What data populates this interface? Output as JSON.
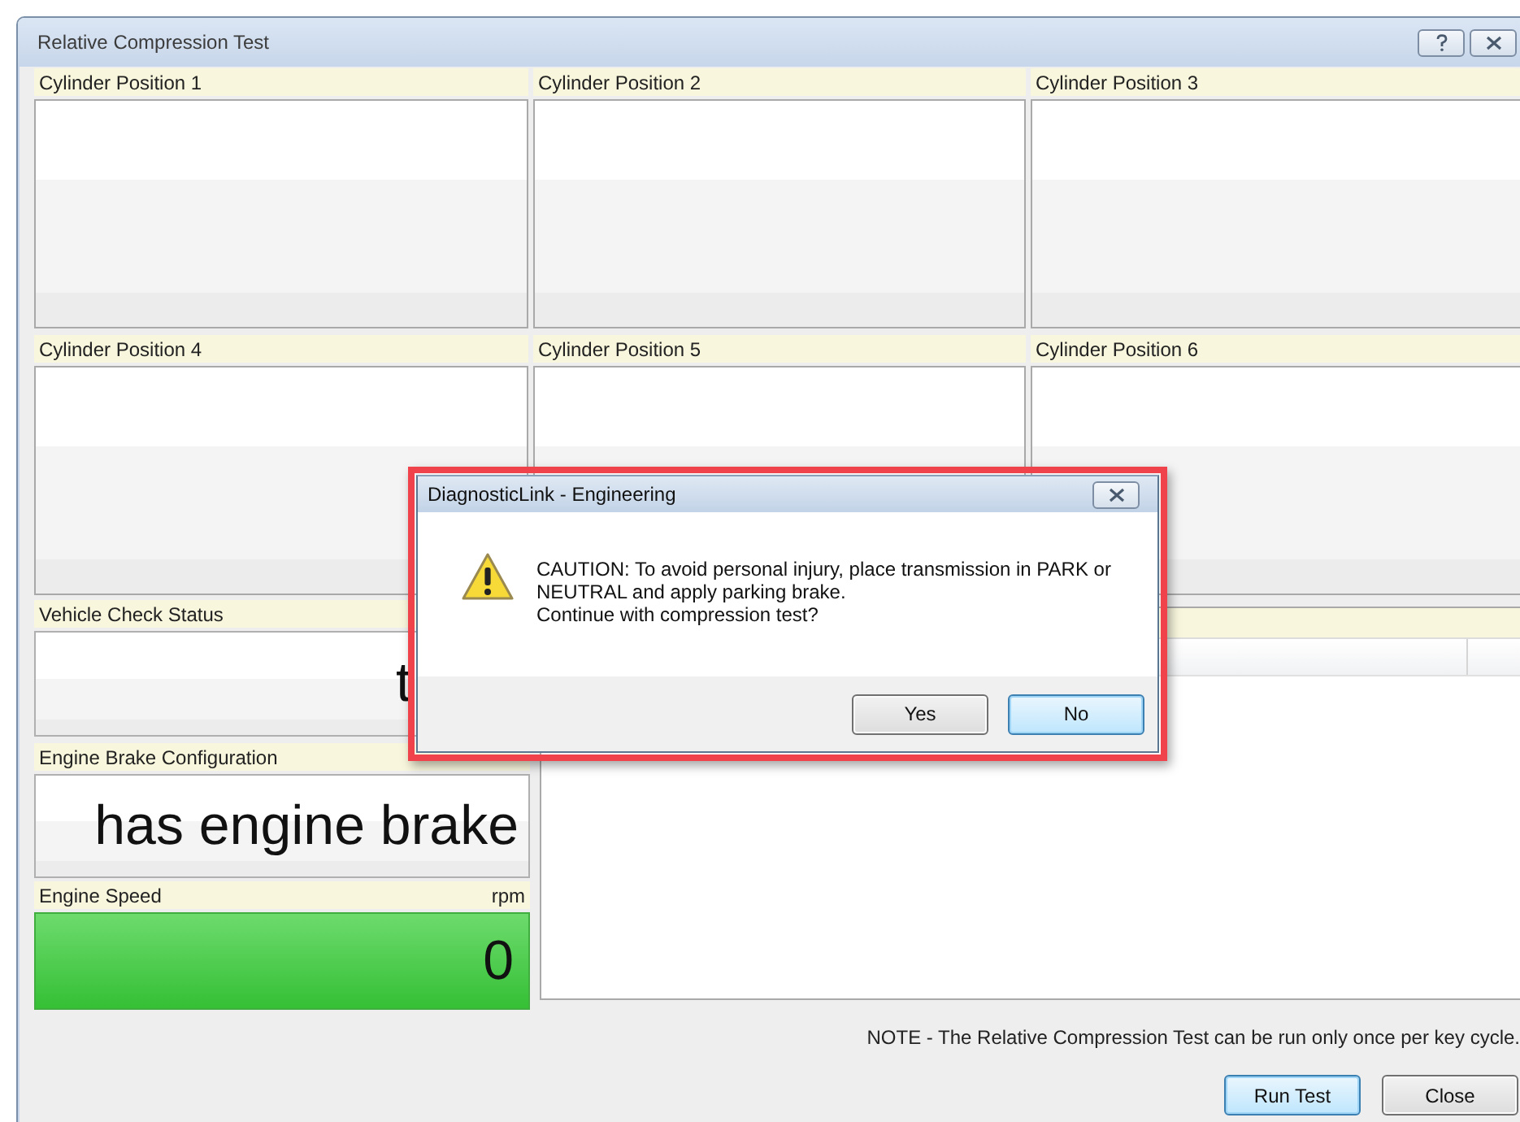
{
  "window": {
    "title": "Relative Compression Test"
  },
  "cylinders": [
    {
      "label": "Cylinder Position 1"
    },
    {
      "label": "Cylinder Position 2"
    },
    {
      "label": "Cylinder Position 3"
    },
    {
      "label": "Cylinder Position 4"
    },
    {
      "label": "Cylinder Position 5"
    },
    {
      "label": "Cylinder Position 6"
    }
  ],
  "vehicle_check_status": {
    "label": "Vehicle Check Status",
    "value": "t"
  },
  "engine_brake_configuration": {
    "label": "Engine Brake Configuration",
    "value": "has engine brake"
  },
  "engine_speed": {
    "label": "Engine Speed",
    "unit": "rpm",
    "value": "0"
  },
  "note": "NOTE - The Relative Compression Test can be run only once per key cycle.",
  "buttons": [
    {
      "label": "Run Test",
      "default": true
    },
    {
      "label": "Close",
      "default": false
    }
  ],
  "dialog": {
    "title": "DiagnosticLink - Engineering",
    "message": "CAUTION: To avoid personal injury, place transmission in PARK or\nNEUTRAL and apply parking brake.\nContinue with compression test?",
    "buttons": [
      {
        "label": "Yes",
        "default": false
      },
      {
        "label": "No",
        "default": true
      }
    ]
  }
}
